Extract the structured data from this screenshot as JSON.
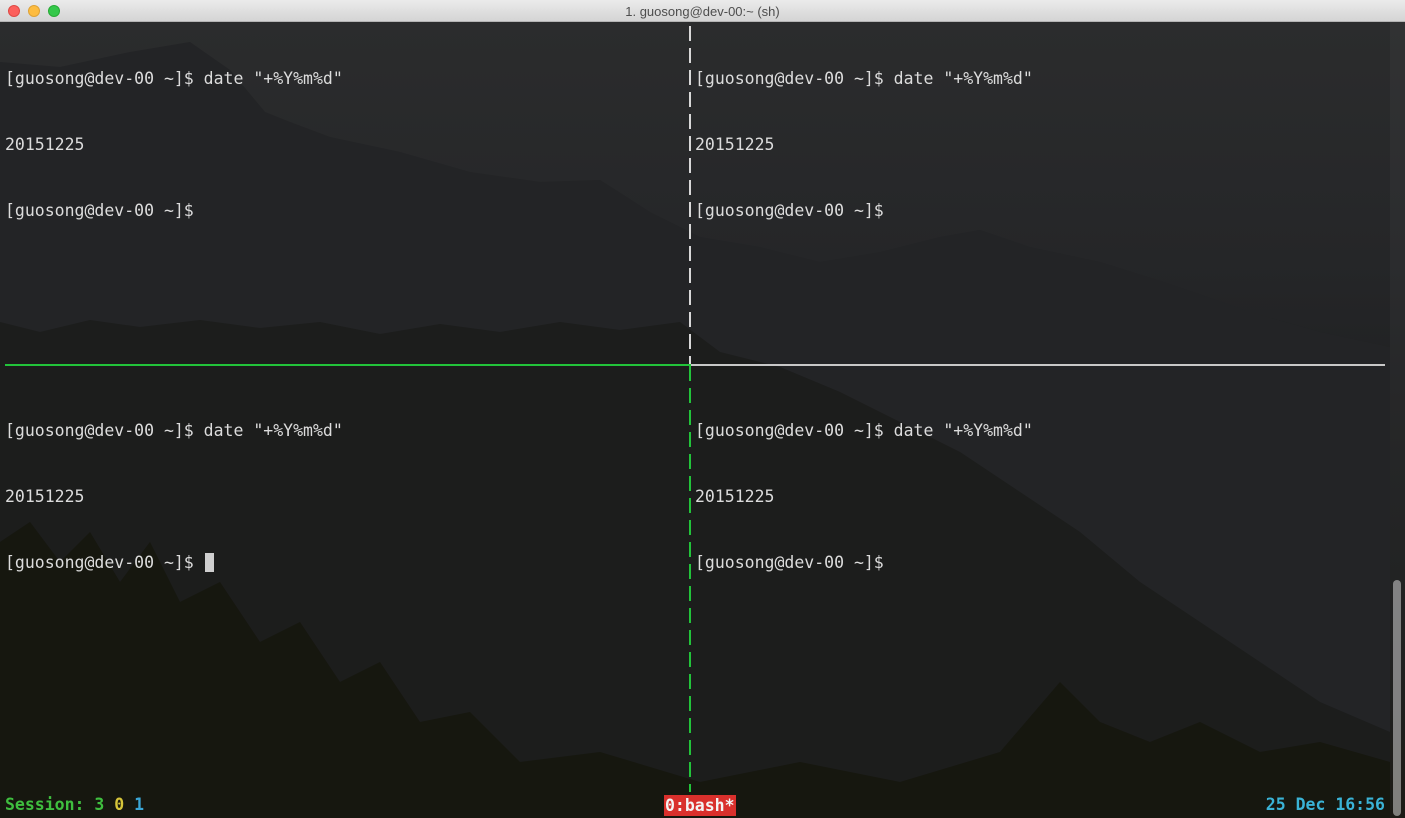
{
  "window": {
    "title": "1. guosong@dev-00:~ (sh)"
  },
  "panes": {
    "top_left": {
      "lines": [
        "[guosong@dev-00 ~]$ date \"+%Y%m%d\"",
        "20151225",
        "[guosong@dev-00 ~]$"
      ]
    },
    "top_right": {
      "lines": [
        "[guosong@dev-00 ~]$ date \"+%Y%m%d\"",
        "20151225",
        "[guosong@dev-00 ~]$"
      ]
    },
    "bottom_left": {
      "lines": [
        "[guosong@dev-00 ~]$ date \"+%Y%m%d\"",
        "20151225",
        "[guosong@dev-00 ~]$ "
      ],
      "active": true
    },
    "bottom_right": {
      "lines": [
        "[guosong@dev-00 ~]$ date \"+%Y%m%d\"",
        "20151225",
        "[guosong@dev-00 ~]$"
      ]
    }
  },
  "status_bar": {
    "session_label": "Session:",
    "session_numbers": [
      "3",
      "0",
      "1"
    ],
    "window_tab": "0:bash*",
    "datetime": "25 Dec 16:56"
  },
  "colors": {
    "active_border": "#22c33a",
    "inactive_border": "#c8c8c8",
    "window_tab_bg": "#d9302c",
    "session_green": "#3fbf3f",
    "session_yellow": "#d6c53a",
    "session_cyan": "#3aa6d6",
    "datetime": "#3ab3d6"
  }
}
